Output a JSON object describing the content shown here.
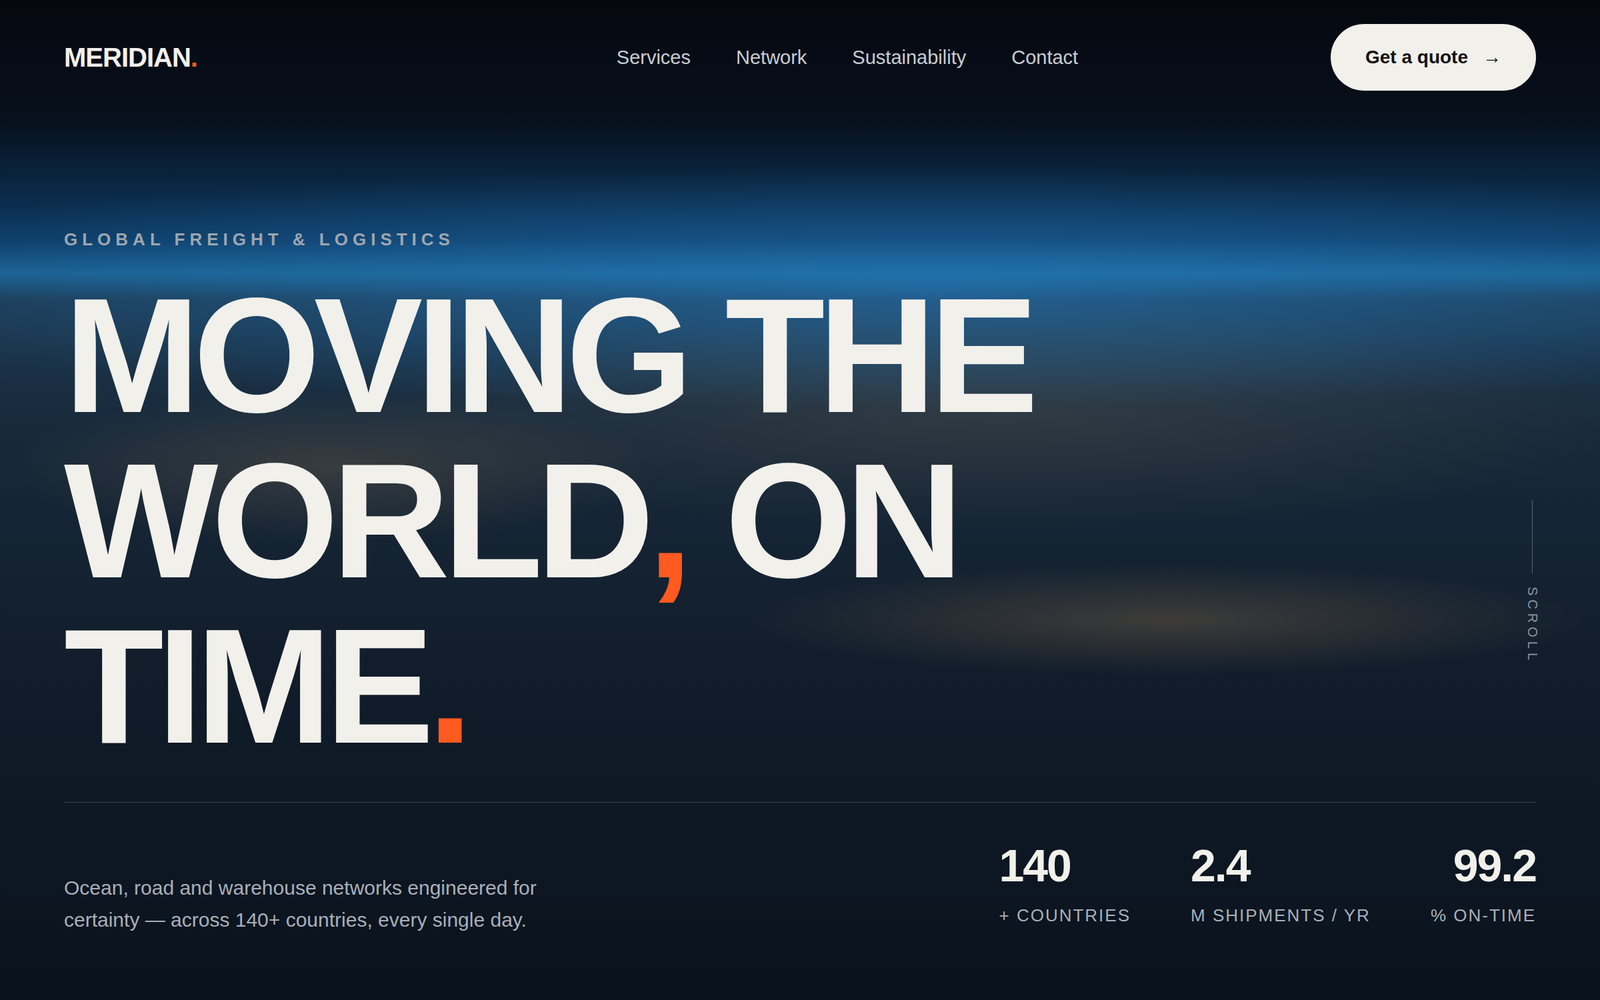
{
  "logo": {
    "name": "MERIDIAN",
    "mark": "."
  },
  "nav": {
    "items": [
      "Services",
      "Network",
      "Sustainability",
      "Contact"
    ]
  },
  "cta": {
    "label": "Get a quote",
    "icon": "→"
  },
  "hero": {
    "eyebrow": "GLOBAL FREIGHT & LOGISTICS",
    "headline": [
      [
        {
          "text": "MOVING THE",
          "accent": false
        }
      ],
      [
        {
          "text": "WORLD",
          "accent": false
        },
        {
          "text": ",",
          "accent": true
        },
        {
          "text": " ON",
          "accent": false
        }
      ],
      [
        {
          "text": "TIME",
          "accent": false
        },
        {
          "text": ".",
          "accent": true
        }
      ]
    ],
    "description": "Ocean, road and warehouse networks engineered for certainty — across 140+ countries, every single day."
  },
  "stats": [
    {
      "value": "140",
      "label": "+ COUNTRIES"
    },
    {
      "value": "2.4",
      "label": "M SHIPMENTS / YR"
    },
    {
      "value": "99.2",
      "label": "% ON-TIME"
    }
  ],
  "scroll": {
    "label": "SCROLL"
  }
}
